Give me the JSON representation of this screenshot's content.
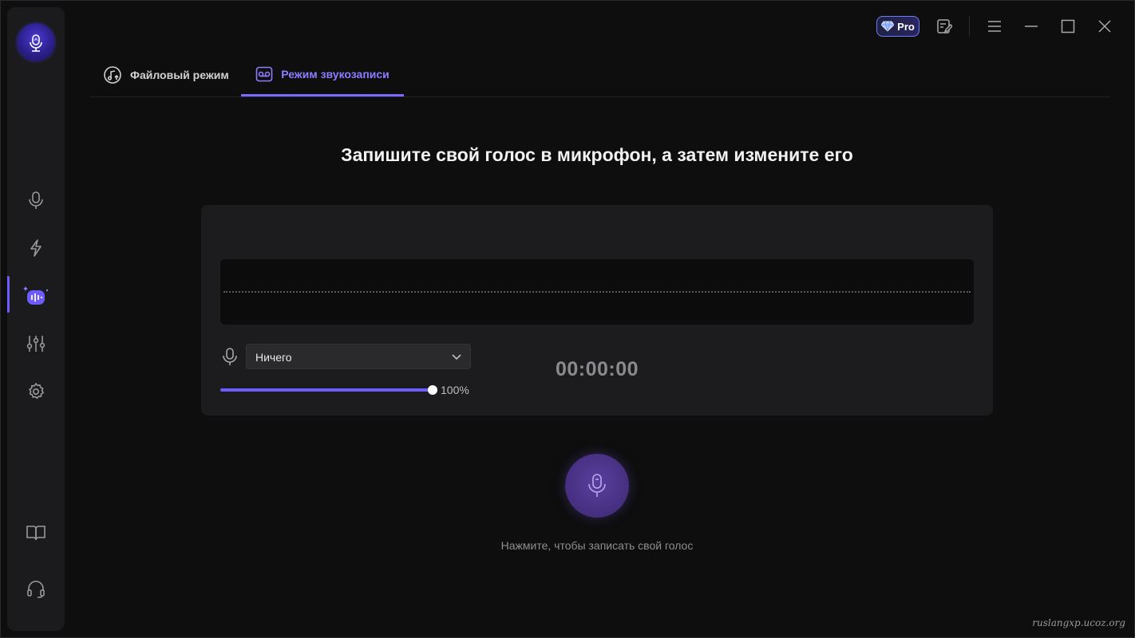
{
  "titlebar": {
    "pro_label": "Pro"
  },
  "tabs": [
    {
      "label": "Файловый режим",
      "active": false
    },
    {
      "label": "Режим звукозаписи",
      "active": true
    }
  ],
  "main": {
    "heading": "Запишите свой голос в микрофон, а затем измените его",
    "microphone": {
      "selected": "Ничего"
    },
    "volume": {
      "percent": 100,
      "label": "100%"
    },
    "timer": "00:00:00",
    "record_hint": "Нажмите, чтобы записать свой голос"
  },
  "watermark": "ruslangxp.ucoz.org",
  "colors": {
    "accent": "#6d5cff",
    "background": "#0e0e0f",
    "panel": "#1c1c1e"
  },
  "icons": {
    "sidebar": [
      "microphone-icon",
      "lightning-icon",
      "voice-effects-icon",
      "equalizer-icon",
      "settings-icon",
      "book-icon",
      "headset-icon"
    ]
  }
}
